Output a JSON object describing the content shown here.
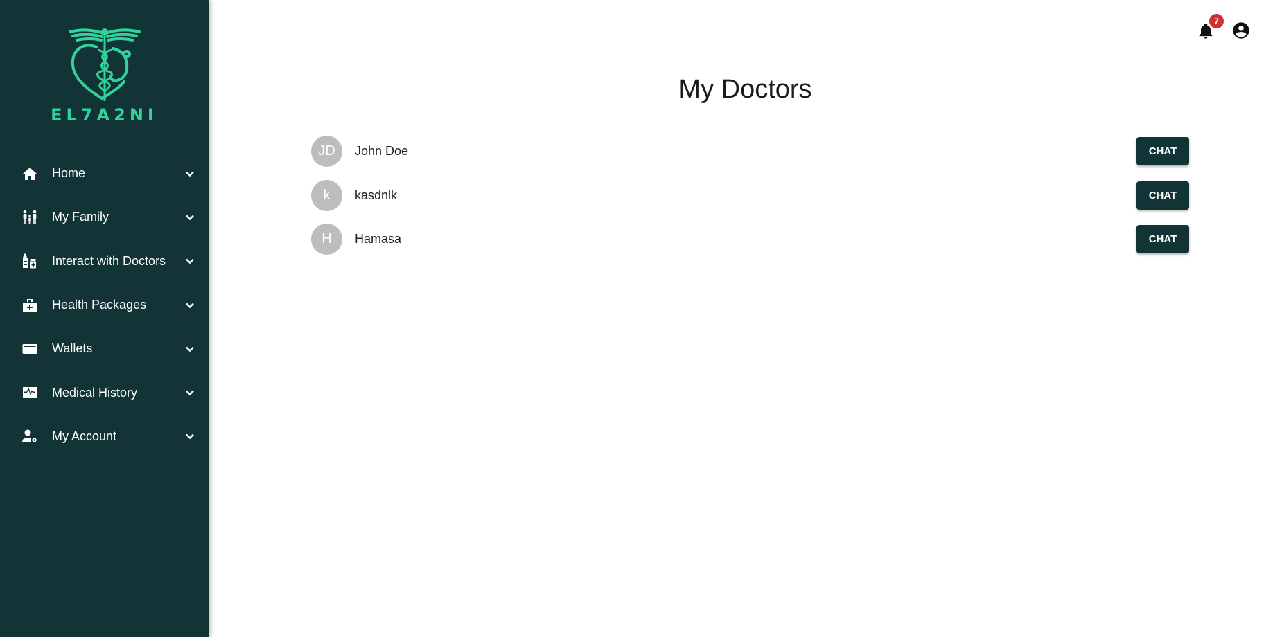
{
  "brand": {
    "name": "EL7A2NI",
    "accent": "#2fd49a",
    "sidebar_bg": "#123436"
  },
  "sidebar": {
    "items": [
      {
        "label": "Home",
        "icon": "home-icon"
      },
      {
        "label": "My Family",
        "icon": "family-icon"
      },
      {
        "label": "Interact with Doctors",
        "icon": "medicine-icon"
      },
      {
        "label": "Health Packages",
        "icon": "medical-kit-icon"
      },
      {
        "label": "Wallets",
        "icon": "wallet-icon"
      },
      {
        "label": "Medical History",
        "icon": "heart-monitor-icon"
      },
      {
        "label": "My Account",
        "icon": "user-settings-icon"
      }
    ]
  },
  "header": {
    "notification_count": "7",
    "notification_badge_color": "#d32f2f"
  },
  "main": {
    "title": "My Doctors",
    "doctors": [
      {
        "initials": "JD",
        "name": "John Doe",
        "action": "CHAT"
      },
      {
        "initials": "k",
        "name": "kasdnlk",
        "action": "CHAT"
      },
      {
        "initials": "H",
        "name": "Hamasa",
        "action": "CHAT"
      }
    ]
  }
}
